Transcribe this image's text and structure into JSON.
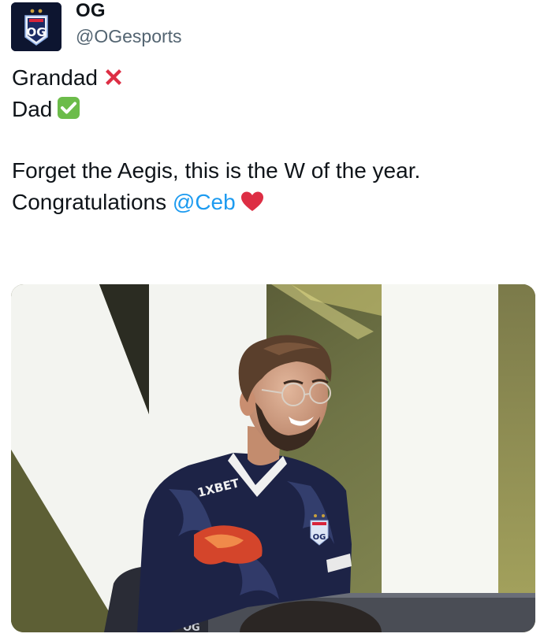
{
  "author": {
    "name": "OG",
    "handle": "@OGesports",
    "avatar": {
      "logo_text": "OG",
      "background": "#0d1530"
    }
  },
  "tweet": {
    "line1": {
      "text": "Grandad",
      "emoji": "cross-mark"
    },
    "line2": {
      "text": "Dad",
      "emoji": "check-mark-button"
    },
    "line3": {
      "text": "Forget the Aegis, this is the W of the year."
    },
    "line4": {
      "text": "Congratulations ",
      "mention": "@Ceb",
      "emoji": "red-heart"
    }
  },
  "photo": {
    "jersey_sponsor": "1XBET",
    "jersey_logo": "OG",
    "chair_text": "OG",
    "mention_color": "#1d9bf0"
  }
}
